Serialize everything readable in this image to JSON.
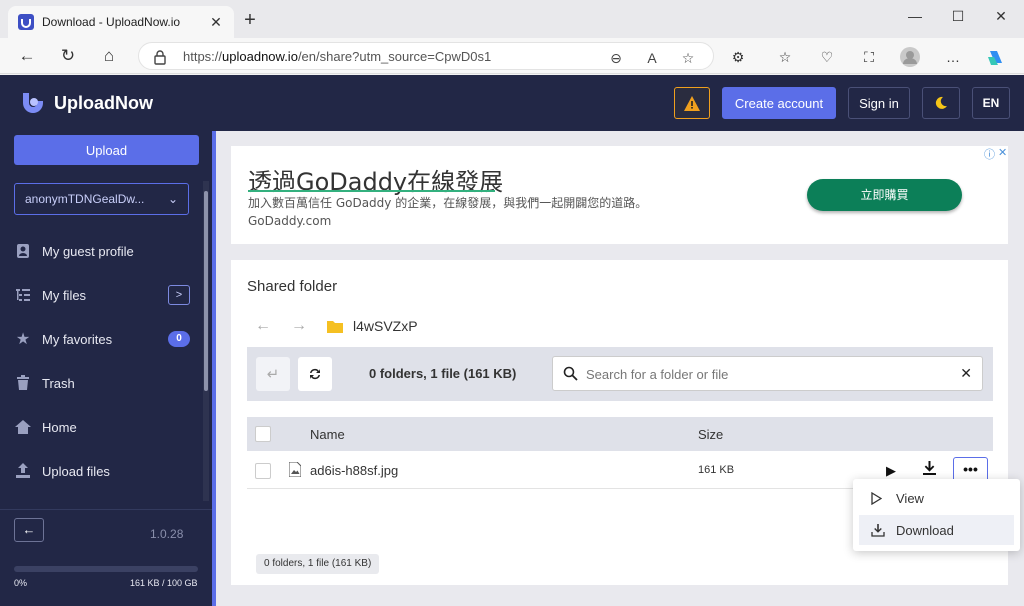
{
  "browser": {
    "tab_title": "Download - UploadNow.io",
    "url_prefix": "https://",
    "url_domain": "uploadnow.io",
    "url_path": "/en/share?utm_source=CpwD0s1"
  },
  "header": {
    "brand": "UploadNow",
    "warning_icon": "warning-icon",
    "create_account": "Create account",
    "sign_in": "Sign in",
    "theme_icon": "moon-icon",
    "language": "EN"
  },
  "sidebar": {
    "upload_label": "Upload",
    "account_name": "anonymTDNGealDw...",
    "items": [
      {
        "label": "My guest profile",
        "icon": "profile-icon"
      },
      {
        "label": "My files",
        "icon": "tree-icon"
      },
      {
        "label": "My favorites",
        "icon": "star-icon",
        "badge": "0"
      },
      {
        "label": "Trash",
        "icon": "trash-icon"
      },
      {
        "label": "Home",
        "icon": "home-icon"
      },
      {
        "label": "Upload files",
        "icon": "upload-icon"
      }
    ],
    "version": "1.0.28",
    "quota_percent_label": "0%",
    "quota_size_label": "161 KB / 100 GB",
    "quota_fraction": 0.0
  },
  "ad": {
    "title": "透過GoDaddy在線發展",
    "desc_line1": "加入數百萬信任 GoDaddy 的企業，在線發展，與我們一起開闢您的道路。",
    "desc_line2": "GoDaddy.com",
    "cta": "立即購買",
    "info": "ⓘ",
    "close": "✕"
  },
  "panel": {
    "title": "Shared folder",
    "folder_name": "l4wSVZxP",
    "summary": "0 folders, 1 file (161 KB)",
    "search_placeholder": "Search for a folder or file",
    "col_name": "Name",
    "col_size": "Size",
    "files": [
      {
        "name": "ad6is-h88sf.jpg",
        "size": "161 KB"
      }
    ],
    "footer_summary": "0 folders, 1 file (161 KB)"
  },
  "context_menu": {
    "view": "View",
    "download": "Download"
  },
  "colors": {
    "accent": "#5b6ee8",
    "sidebar_bg": "#222746",
    "warning": "#f0a01e",
    "ad_cta": "#0c7f58"
  }
}
